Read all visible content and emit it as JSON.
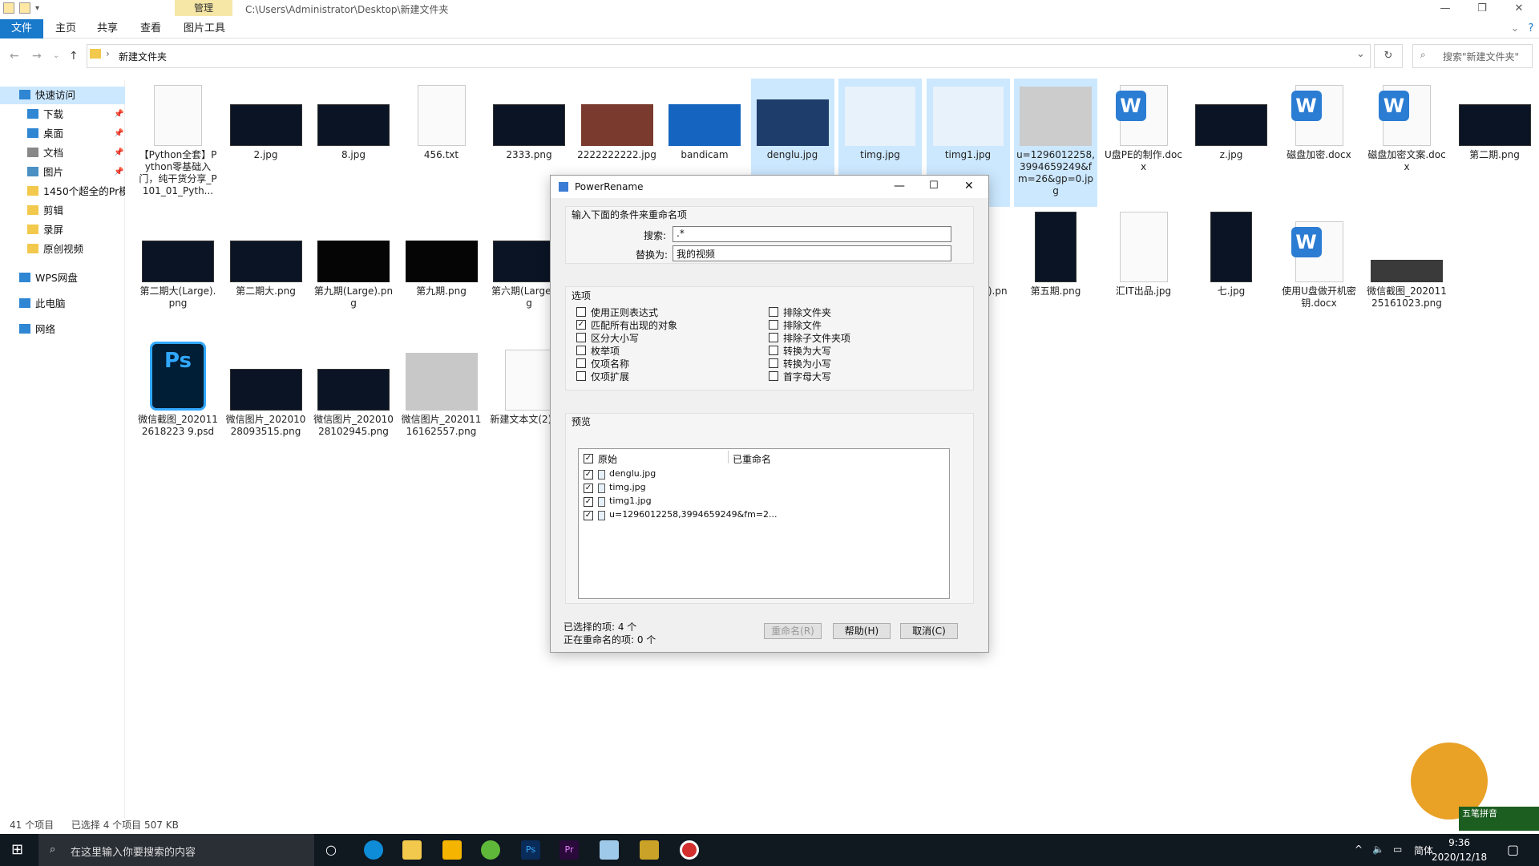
{
  "window": {
    "manage_tab": "管理",
    "title_path": "C:\\Users\\Administrator\\Desktop\\新建文件夹",
    "ribbon_tabs": [
      "文件",
      "主页",
      "共享",
      "查看",
      "图片工具"
    ]
  },
  "address": {
    "path": "新建文件夹",
    "search_placeholder": "搜索\"新建文件夹\""
  },
  "nav": [
    {
      "label": "快速访问",
      "icon": "star-icon"
    },
    {
      "label": "下载",
      "icon": "download-icon",
      "pinned": true
    },
    {
      "label": "桌面",
      "icon": "desktop-icon",
      "pinned": true
    },
    {
      "label": "文档",
      "icon": "document-icon",
      "pinned": true
    },
    {
      "label": "图片",
      "icon": "picture-icon",
      "pinned": true
    },
    {
      "label": "1450个超全的Pr模板",
      "icon": "folder-icon"
    },
    {
      "label": "剪辑",
      "icon": "folder-icon"
    },
    {
      "label": "录屏",
      "icon": "folder-icon"
    },
    {
      "label": "原创视频",
      "icon": "folder-icon"
    },
    {
      "label": "WPS网盘",
      "icon": "cloud-icon"
    },
    {
      "label": "此电脑",
      "icon": "computer-icon"
    },
    {
      "label": "网络",
      "icon": "network-icon"
    }
  ],
  "files": [
    {
      "name": "【Python全套】Python零基础入门，纯干货分享_P101_01_Pyth...",
      "kind": "doc"
    },
    {
      "name": "2.jpg",
      "kind": "dark"
    },
    {
      "name": "8.jpg",
      "kind": "dark"
    },
    {
      "name": "456.txt",
      "kind": "doc"
    },
    {
      "name": "2333.png",
      "kind": "dark"
    },
    {
      "name": "2222222222.jpg",
      "kind": "photo"
    },
    {
      "name": "bandicam",
      "kind": "video"
    },
    {
      "name": "denglu.jpg",
      "kind": "blue",
      "selected": true
    },
    {
      "name": "timg.jpg",
      "kind": "monitor",
      "selected": true
    },
    {
      "name": "timg1.jpg",
      "kind": "monitor",
      "selected": true
    },
    {
      "name": "u=1296012258,3994659249&fm=26&gp=0.jpg",
      "kind": "imac",
      "selected": true
    },
    {
      "name": "U盘PE的制作.docx",
      "kind": "word"
    },
    {
      "name": "z.jpg",
      "kind": "dark"
    },
    {
      "name": "磁盘加密.docx",
      "kind": "word"
    },
    {
      "name": "磁盘加密文案.docx",
      "kind": "word"
    },
    {
      "name": "第二期.png",
      "kind": "dark"
    },
    {
      "name": "第二期大(Large).png",
      "kind": "dark"
    },
    {
      "name": "第二期大.png",
      "kind": "dark"
    },
    {
      "name": "第九期(Large).png",
      "kind": "black"
    },
    {
      "name": "第九期.png",
      "kind": "black"
    },
    {
      "name": "第六期(Large).jpg",
      "kind": "dark"
    },
    {
      "name": "第五期(Large).png",
      "kind": "tall"
    },
    {
      "name": "第五期.png",
      "kind": "tall"
    },
    {
      "name": "汇IT出品.jpg",
      "kind": "tallwhite"
    },
    {
      "name": "七.jpg",
      "kind": "tall"
    },
    {
      "name": "使用U盘做开机密钥.docx",
      "kind": "word"
    },
    {
      "name": "微信截图_20201125161023.png",
      "kind": "grey"
    },
    {
      "name": "微信截图_2020112618223 9.psd",
      "kind": "psd"
    },
    {
      "name": "微信图片_20201028093515.png",
      "kind": "dark"
    },
    {
      "name": "微信图片_20201028102945.png",
      "kind": "dark"
    },
    {
      "name": "微信图片_20201116162557.png",
      "kind": "itlogo"
    },
    {
      "name": "新建文本文(2).txt",
      "kind": "doc"
    }
  ],
  "dialog": {
    "title": "PowerRename",
    "criteria_heading": "输入下面的条件来重命名项",
    "search_label": "搜索:",
    "search_value": ".*",
    "replace_label": "替换为:",
    "replace_value": "我的视频",
    "options_heading": "选项",
    "options_left": [
      {
        "label": "使用正则表达式",
        "checked": false
      },
      {
        "label": "匹配所有出现的对象",
        "checked": true
      },
      {
        "label": "区分大小写",
        "checked": false
      },
      {
        "label": "枚举项",
        "checked": false
      },
      {
        "label": "仅项名称",
        "checked": false
      },
      {
        "label": "仅项扩展",
        "checked": false
      }
    ],
    "options_right": [
      {
        "label": "排除文件夹",
        "checked": false
      },
      {
        "label": "排除文件",
        "checked": false
      },
      {
        "label": "排除子文件夹项",
        "checked": false
      },
      {
        "label": "转换为大写",
        "checked": false
      },
      {
        "label": "转换为小写",
        "checked": false
      },
      {
        "label": "首字母大写",
        "checked": false
      }
    ],
    "preview_heading": "预览",
    "col_original": "原始",
    "col_renamed": "已重命名",
    "preview_items": [
      "denglu.jpg",
      "timg.jpg",
      "timg1.jpg",
      "u=1296012258,3994659249&fm=2..."
    ],
    "selected_count": "已选择的项: 4 个",
    "renaming_count": "正在重命名的项: 0 个",
    "btn_rename": "重命名(R)",
    "btn_help": "帮助(H)",
    "btn_cancel": "取消(C)"
  },
  "status": {
    "count": "41 个项目",
    "selection": "已选择 4 个项目  507 KB"
  },
  "taskbar": {
    "search_text": "在这里输入你要搜索的内容",
    "time": "9:36",
    "date": "2020/12/18",
    "ime_lang": "简体",
    "ime_name": "五笔拼音"
  }
}
